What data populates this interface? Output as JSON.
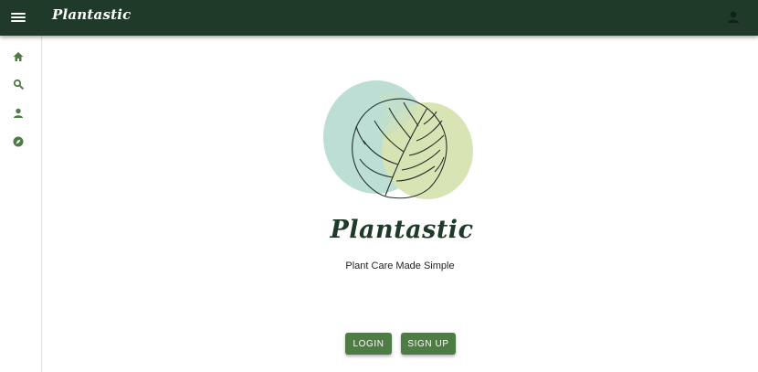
{
  "header": {
    "app_title": "Plantastic",
    "menu_icon": "hamburger-menu-icon",
    "account_icon": "account-icon",
    "background_color": "#1f3a28"
  },
  "sidebar": {
    "items": [
      {
        "name": "home",
        "icon": "home-icon"
      },
      {
        "name": "search",
        "icon": "search-icon"
      },
      {
        "name": "profile",
        "icon": "person-icon"
      },
      {
        "name": "explore",
        "icon": "explore-icon"
      }
    ],
    "icon_color": "#4f7b44"
  },
  "main": {
    "brand_name": "Plantastic",
    "tagline": "Plant Care Made Simple",
    "login_label": "LOGIN",
    "signup_label": "SIGN UP",
    "accent_color": "#4f7b44"
  }
}
